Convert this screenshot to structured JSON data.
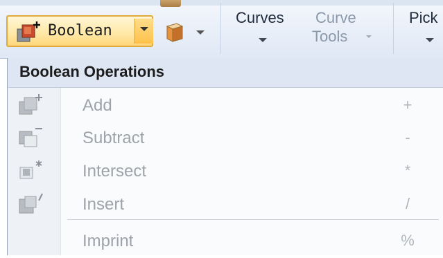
{
  "ribbon": {
    "boolean_button": {
      "label": "Boolean",
      "icon": "boolean-add-icon",
      "dropdown_icon": "chevron-down-icon"
    },
    "box_button": {
      "icon": "box-3d-icon",
      "dropdown_icon": "chevron-down-icon"
    },
    "curves": {
      "label": "Curves"
    },
    "curve_tools": {
      "line1": "Curve",
      "line2": "Tools"
    },
    "pick": {
      "label": "Pick"
    },
    "accent_color": "#ffd67a"
  },
  "menu": {
    "title": "Boolean Operations",
    "items": [
      {
        "label": "Add",
        "shortcut": "+",
        "icon": "boolean-add-icon",
        "enabled": false
      },
      {
        "label": "Subtract",
        "shortcut": "-",
        "icon": "boolean-subtract-icon",
        "enabled": false
      },
      {
        "label": "Intersect",
        "shortcut": "*",
        "icon": "boolean-intersect-icon",
        "enabled": false
      },
      {
        "label": "Insert",
        "shortcut": "/",
        "icon": "boolean-insert-icon",
        "enabled": false
      },
      {
        "label": "Imprint",
        "shortcut": "%",
        "icon": "boolean-imprint-icon",
        "enabled": false
      }
    ],
    "disabled_text_color": "#9ea3aa"
  }
}
